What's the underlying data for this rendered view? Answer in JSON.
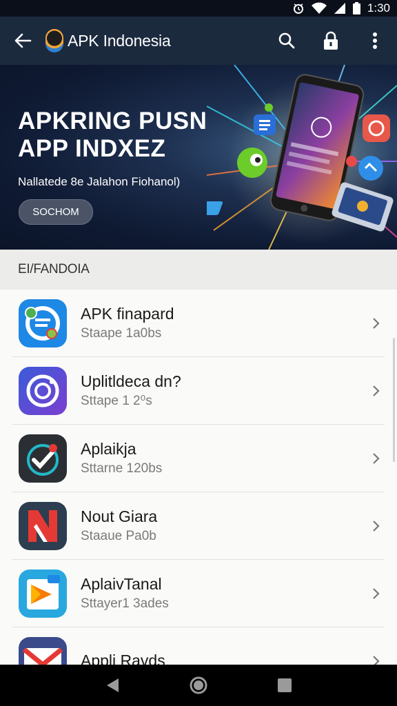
{
  "status_bar": {
    "time": "1:30"
  },
  "app_bar": {
    "title": "APK Indonesia"
  },
  "hero": {
    "title": "APKRING PUSN\nAPP INDXEZ",
    "subtitle": "Nallatede 8e Jalahon Fiohanol)",
    "button_label": "SOCHOM"
  },
  "section": {
    "header": "EI/FANDOIA"
  },
  "apps": [
    {
      "name": "APK finapard",
      "subtitle": "Staape 1a0bs",
      "icon": "chat-app-icon",
      "color": "#1e88e5"
    },
    {
      "name": "Uplitldeca dn?",
      "subtitle": "Sttape 1 2⁰s",
      "icon": "camera-ring-app-icon",
      "color": "#5b3ccf"
    },
    {
      "name": "Aplaikja",
      "subtitle": "Sttarne 120bs",
      "icon": "checkmark-app-icon",
      "color": "#2b2f33"
    },
    {
      "name": "Nout Giara",
      "subtitle": "Staaue Pa0b",
      "icon": "n-letter-app-icon",
      "color": "#d32f2f"
    },
    {
      "name": "AplaivTanal",
      "subtitle": "Sttayer1 3ades",
      "icon": "play-store-app-icon",
      "color": "#29a8e0"
    },
    {
      "name": "Appli Ravds",
      "subtitle": "",
      "icon": "mail-app-icon",
      "color": "#e53935"
    }
  ]
}
